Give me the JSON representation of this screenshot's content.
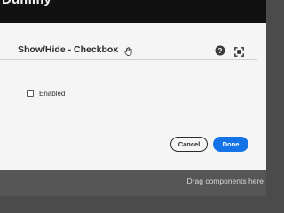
{
  "page": {
    "title": "Dummy"
  },
  "dialog": {
    "title": "Show/Hide - Checkbox",
    "icons": {
      "drag": "drag-hand-icon",
      "help": "help-icon",
      "fullscreen": "fullscreen-icon"
    },
    "checkbox": {
      "label": "Enabled",
      "checked": false
    },
    "buttons": {
      "cancel": "Cancel",
      "done": "Done"
    },
    "accent_color": "#1473e6"
  },
  "underlay": {
    "drag_hint": "Drag components here"
  }
}
